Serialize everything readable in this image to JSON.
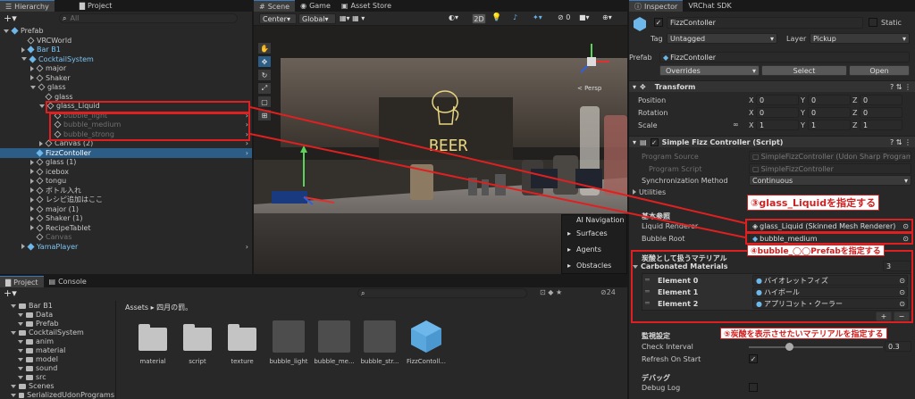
{
  "hierarchy": {
    "tabs": [
      "Hierarchy",
      "Project"
    ],
    "search_placeholder": "All",
    "items": [
      {
        "label": "Prefab",
        "style": "normal"
      },
      {
        "label": "VRCWorld",
        "style": "normal"
      },
      {
        "label": "Bar B1",
        "style": "blue"
      },
      {
        "label": "CocktailSystem",
        "style": "blue"
      },
      {
        "label": "major",
        "style": "normal"
      },
      {
        "label": "Shaker",
        "style": "normal"
      },
      {
        "label": "glass",
        "style": "normal"
      },
      {
        "label": "glass",
        "style": "normal"
      },
      {
        "label": "glass_Liquid",
        "style": "normal"
      },
      {
        "label": "bubble_light",
        "style": "faint"
      },
      {
        "label": "bubble_medium",
        "style": "faint"
      },
      {
        "label": "bubble_strong",
        "style": "faint"
      },
      {
        "label": "Canvas (2)",
        "style": "normal"
      },
      {
        "label": "FizzContoller",
        "style": "selected"
      },
      {
        "label": "glass (1)",
        "style": "normal"
      },
      {
        "label": "icebox",
        "style": "normal"
      },
      {
        "label": "tongu",
        "style": "normal"
      },
      {
        "label": "ボトル入れ",
        "style": "normal"
      },
      {
        "label": "レシピ追加はここ",
        "style": "normal"
      },
      {
        "label": "major (1)",
        "style": "normal"
      },
      {
        "label": "Shaker (1)",
        "style": "normal"
      },
      {
        "label": "RecipeTablet",
        "style": "normal"
      },
      {
        "label": "Canvas",
        "style": "faint"
      },
      {
        "label": "YamaPlayer",
        "style": "blue"
      }
    ]
  },
  "scene": {
    "tabs": [
      "Scene",
      "Game",
      "Asset Store"
    ],
    "pivot": "Center",
    "space": "Global",
    "mode_2d": "2D",
    "persp_label": "< Persp",
    "beer_sign": "BEER",
    "nav_overlay": {
      "title": "AI Navigation",
      "items": [
        "Surfaces",
        "Agents",
        "Obstacles"
      ]
    }
  },
  "project": {
    "tabs": [
      "Project",
      "Console"
    ],
    "tree": [
      {
        "label": "Bar B1",
        "indent": 1
      },
      {
        "label": "Data",
        "indent": 2
      },
      {
        "label": "Prefab",
        "indent": 2
      },
      {
        "label": "CocktailSystem",
        "indent": 1
      },
      {
        "label": "anim",
        "indent": 2
      },
      {
        "label": "material",
        "indent": 2
      },
      {
        "label": "model",
        "indent": 2
      },
      {
        "label": "sound",
        "indent": 2
      },
      {
        "label": "src",
        "indent": 2
      },
      {
        "label": "Scenes",
        "indent": 1
      },
      {
        "label": "SerializedUdonPrograms",
        "indent": 1
      }
    ],
    "breadcrumb": [
      "Assets",
      "四月の罰。"
    ],
    "count": "24",
    "assets": [
      "material",
      "script",
      "texture",
      "bubble_light",
      "bubble_me...",
      "bubble_str...",
      "FizzContoll..."
    ]
  },
  "inspector": {
    "tabs": [
      "Inspector",
      "VRChat SDK"
    ],
    "object_name": "FizzContoller",
    "static_label": "Static",
    "tag_label": "Tag",
    "tag_value": "Untagged",
    "layer_label": "Layer",
    "layer_value": "Pickup",
    "prefab_label": "Prefab",
    "prefab_value": "FizzContoller",
    "overrides": "Overrides",
    "select": "Select",
    "open": "Open",
    "transform": {
      "title": "Transform",
      "rows": [
        {
          "label": "Position",
          "x": "0",
          "y": "0",
          "z": "0"
        },
        {
          "label": "Rotation",
          "x": "0",
          "y": "0",
          "z": "0"
        },
        {
          "label": "Scale",
          "x": "1",
          "y": "1",
          "z": "1"
        }
      ]
    },
    "script": {
      "title": "Simple Fizz Controller (Script)",
      "program_source_label": "Program Source",
      "program_source": "SimpleFizzController (Udon Sharp Program",
      "program_script_label": "Program Script",
      "program_script": "SimpleFizzController",
      "sync_label": "Synchronization Method",
      "sync_value": "Continuous",
      "utilities": "Utilities",
      "section_basic": "基本参照",
      "liquid_label": "Liquid Renderer",
      "liquid_value": "glass_Liquid (Skinned Mesh Renderer)",
      "bubble_label": "Bubble Root",
      "bubble_value": "bubble_medium",
      "section_material": "炭酸として扱うマテリアル",
      "carbonated_label": "Carbonated Materials",
      "carbonated_count": "3",
      "elements": [
        {
          "label": "Element 0",
          "value": "バイオレットフィズ"
        },
        {
          "label": "Element 1",
          "value": "ハイボール"
        },
        {
          "label": "Element 2",
          "value": "アプリコット・クーラー"
        }
      ],
      "plus": "+",
      "minus": "−",
      "section_monitor": "監視設定",
      "check_label": "Check Interval",
      "check_value": "0.3",
      "check_fraction": 0.3,
      "refresh_label": "Refresh On Start",
      "section_debug": "デバッグ",
      "debug_label": "Debug Log"
    }
  },
  "annotations": {
    "a3": "③glass_Liquidを指定する",
    "a4": "④bubble_◯◯Prefabを指定する",
    "a5": "⑤炭酸を表示させたいマテリアルを指定する"
  },
  "colors": {
    "accent": "#2c5d87",
    "annotation_red": "#e02020",
    "prefab_blue": "#6db7ea"
  }
}
